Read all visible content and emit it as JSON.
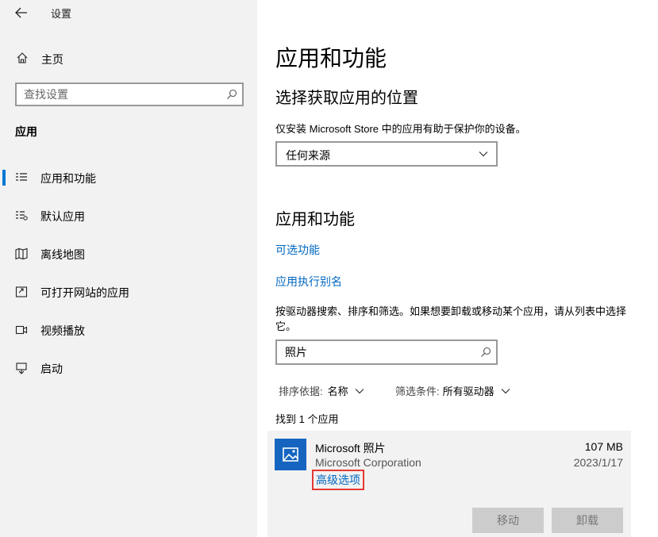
{
  "window": {
    "title": "设置"
  },
  "sidebar": {
    "home_label": "主页",
    "search_placeholder": "查找设置",
    "section_header": "应用",
    "items": [
      {
        "label": "应用和功能",
        "icon": "list-icon",
        "selected": true
      },
      {
        "label": "默认应用",
        "icon": "default-apps-icon",
        "selected": false
      },
      {
        "label": "离线地图",
        "icon": "map-icon",
        "selected": false
      },
      {
        "label": "可打开网站的应用",
        "icon": "open-web-icon",
        "selected": false
      },
      {
        "label": "视频播放",
        "icon": "video-icon",
        "selected": false
      },
      {
        "label": "启动",
        "icon": "startup-icon",
        "selected": false
      }
    ]
  },
  "main": {
    "title": "应用和功能",
    "location_section": {
      "heading": "选择获取应用的位置",
      "description": "仅安装 Microsoft Store 中的应用有助于保护你的设备。",
      "dropdown_value": "任何来源"
    },
    "apps_section": {
      "heading": "应用和功能",
      "link_optional": "可选功能",
      "link_alias": "应用执行别名",
      "description": "按驱动器搜索、排序和筛选。如果想要卸载或移动某个应用，请从列表中选择它。",
      "search_value": "照片",
      "sort_key": "排序依据:",
      "sort_value": "名称",
      "filter_key": "筛选条件:",
      "filter_value": "所有驱动器",
      "found_text": "找到 1 个应用"
    },
    "app": {
      "name": "Microsoft 照片",
      "publisher": "Microsoft Corporation",
      "size": "107 MB",
      "date": "2023/1/17",
      "advanced_link": "高级选项",
      "move_button": "移动",
      "uninstall_button": "卸载"
    }
  },
  "colors": {
    "accent": "#0078d4",
    "link": "#0067c0",
    "highlight_box": "#e53935",
    "sidebar_bg": "#f2f2f2"
  }
}
